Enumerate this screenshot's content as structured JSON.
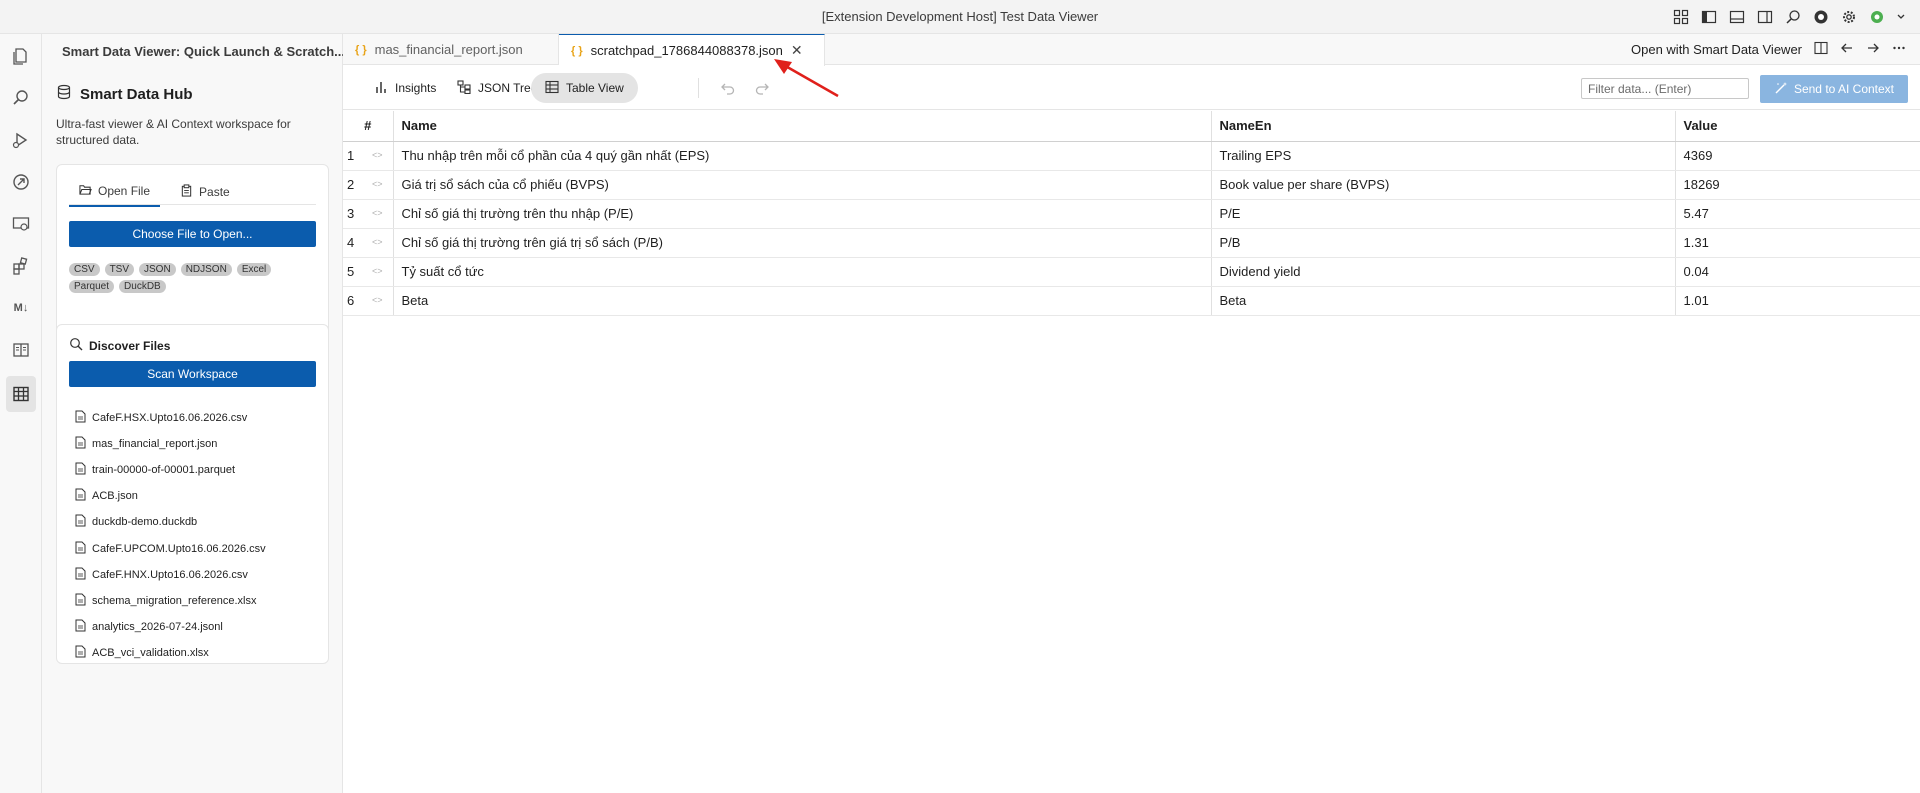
{
  "window": {
    "title": "[Extension Development Host] Test Data Viewer"
  },
  "sidebar": {
    "header": "Smart Data Viewer: Quick Launch & Scratch...",
    "hub_title": "Smart Data Hub",
    "hub_description": "Ultra-fast viewer & AI Context workspace for structured data.",
    "tabs": [
      {
        "label": "Open File",
        "icon": "folder-open-icon"
      },
      {
        "label": "Paste",
        "icon": "clipboard-icon"
      }
    ],
    "choose_file_label": "Choose File to Open...",
    "formats": [
      "CSV",
      "TSV",
      "JSON",
      "NDJSON",
      "Excel",
      "Parquet",
      "DuckDB"
    ],
    "discover_title": "Discover Files",
    "scan_label": "Scan Workspace",
    "files": [
      "CafeF.HSX.Upto16.06.2026.csv",
      "mas_financial_report.json",
      "train-00000-of-00001.parquet",
      "ACB.json",
      "duckdb-demo.duckdb",
      "CafeF.UPCOM.Upto16.06.2026.csv",
      "CafeF.HNX.Upto16.06.2026.csv",
      "schema_migration_reference.xlsx",
      "analytics_2026-07-24.jsonl",
      "ACB_vci_validation.xlsx"
    ]
  },
  "editor_tabs": [
    {
      "label": "mas_financial_report.json",
      "active": false
    },
    {
      "label": "scratchpad_1786844088378.json",
      "active": true
    }
  ],
  "editor_actions": {
    "open_with": "Open with Smart Data Viewer"
  },
  "toolbar": {
    "insights_label": "Insights",
    "json_tree_label": "JSON Tree",
    "table_view_label": "Table View",
    "filter_placeholder": "Filter data... (Enter)",
    "send_ai_label": "Send to AI Context"
  },
  "table": {
    "columns": [
      "#",
      "Name",
      "NameEn",
      "Value"
    ],
    "rows": [
      {
        "n": "1",
        "name": "Thu nhập trên mỗi cổ phần của 4 quý gần nhất (EPS)",
        "name_en": "Trailing EPS",
        "value": "4369"
      },
      {
        "n": "2",
        "name": "Giá trị sổ sách của cổ phiếu (BVPS)",
        "name_en": "Book value per share (BVPS)",
        "value": "18269"
      },
      {
        "n": "3",
        "name": "Chỉ số giá thị trường trên thu nhập (P/E)",
        "name_en": "P/E",
        "value": "5.47"
      },
      {
        "n": "4",
        "name": "Chỉ số giá thị trường trên giá trị sổ sách (P/B)",
        "name_en": "P/B",
        "value": "1.31"
      },
      {
        "n": "5",
        "name": "Tỷ suất cổ tức",
        "name_en": "Dividend yield",
        "value": "0.04"
      },
      {
        "n": "6",
        "name": "Beta",
        "name_en": "Beta",
        "value": "1.01"
      }
    ]
  },
  "colors": {
    "accent": "#0b5cad",
    "annotation": "#e0201b",
    "json_brace": "#e8a317"
  },
  "markdown_icon_label": "M↓"
}
